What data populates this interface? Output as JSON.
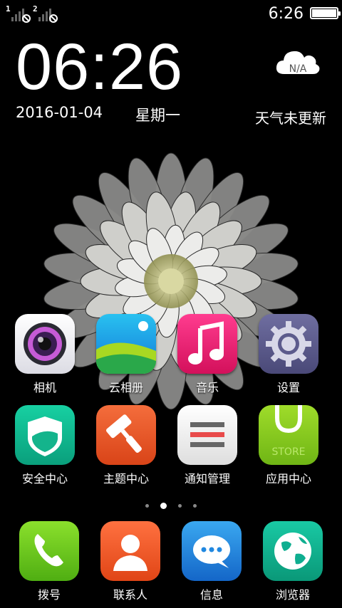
{
  "status_bar": {
    "sim1_label": "1",
    "sim2_label": "2",
    "time": "6:26",
    "battery_level": 1.0
  },
  "lockscreen": {
    "clock": "06:26",
    "date": "2016-01-04",
    "weekday": "星期一",
    "weather_value": "N/A",
    "weather_status": "天气未更新"
  },
  "apps": [
    {
      "label": "相机",
      "icon": "camera-icon",
      "color": "#e9e9f0"
    },
    {
      "label": "云相册",
      "icon": "cloud-album-icon",
      "color": "#1fa8e8"
    },
    {
      "label": "音乐",
      "icon": "music-note-icon",
      "color": "#e3186a"
    },
    {
      "label": "设置",
      "icon": "gear-icon",
      "color": "#5d5c8c"
    },
    {
      "label": "安全中心",
      "icon": "shield-icon",
      "color": "#10b78f"
    },
    {
      "label": "主题中心",
      "icon": "paint-roller-icon",
      "color": "#ea5a2c"
    },
    {
      "label": "通知管理",
      "icon": "notification-list-icon",
      "color": "#f2f2f2"
    },
    {
      "label": "应用中心",
      "icon": "store-bag-icon",
      "color": "#8ccc1c"
    }
  ],
  "store_icon_text": "STORE",
  "pages": {
    "count": 4,
    "current": 2
  },
  "dock": [
    {
      "label": "拨号",
      "icon": "phone-icon",
      "color": "#6cc51d"
    },
    {
      "label": "联系人",
      "icon": "contacts-icon",
      "color": "#ef5a2a"
    },
    {
      "label": "信息",
      "icon": "message-bubble-icon",
      "color": "#2188e0"
    },
    {
      "label": "浏览器",
      "icon": "globe-icon",
      "color": "#0fae90"
    }
  ]
}
